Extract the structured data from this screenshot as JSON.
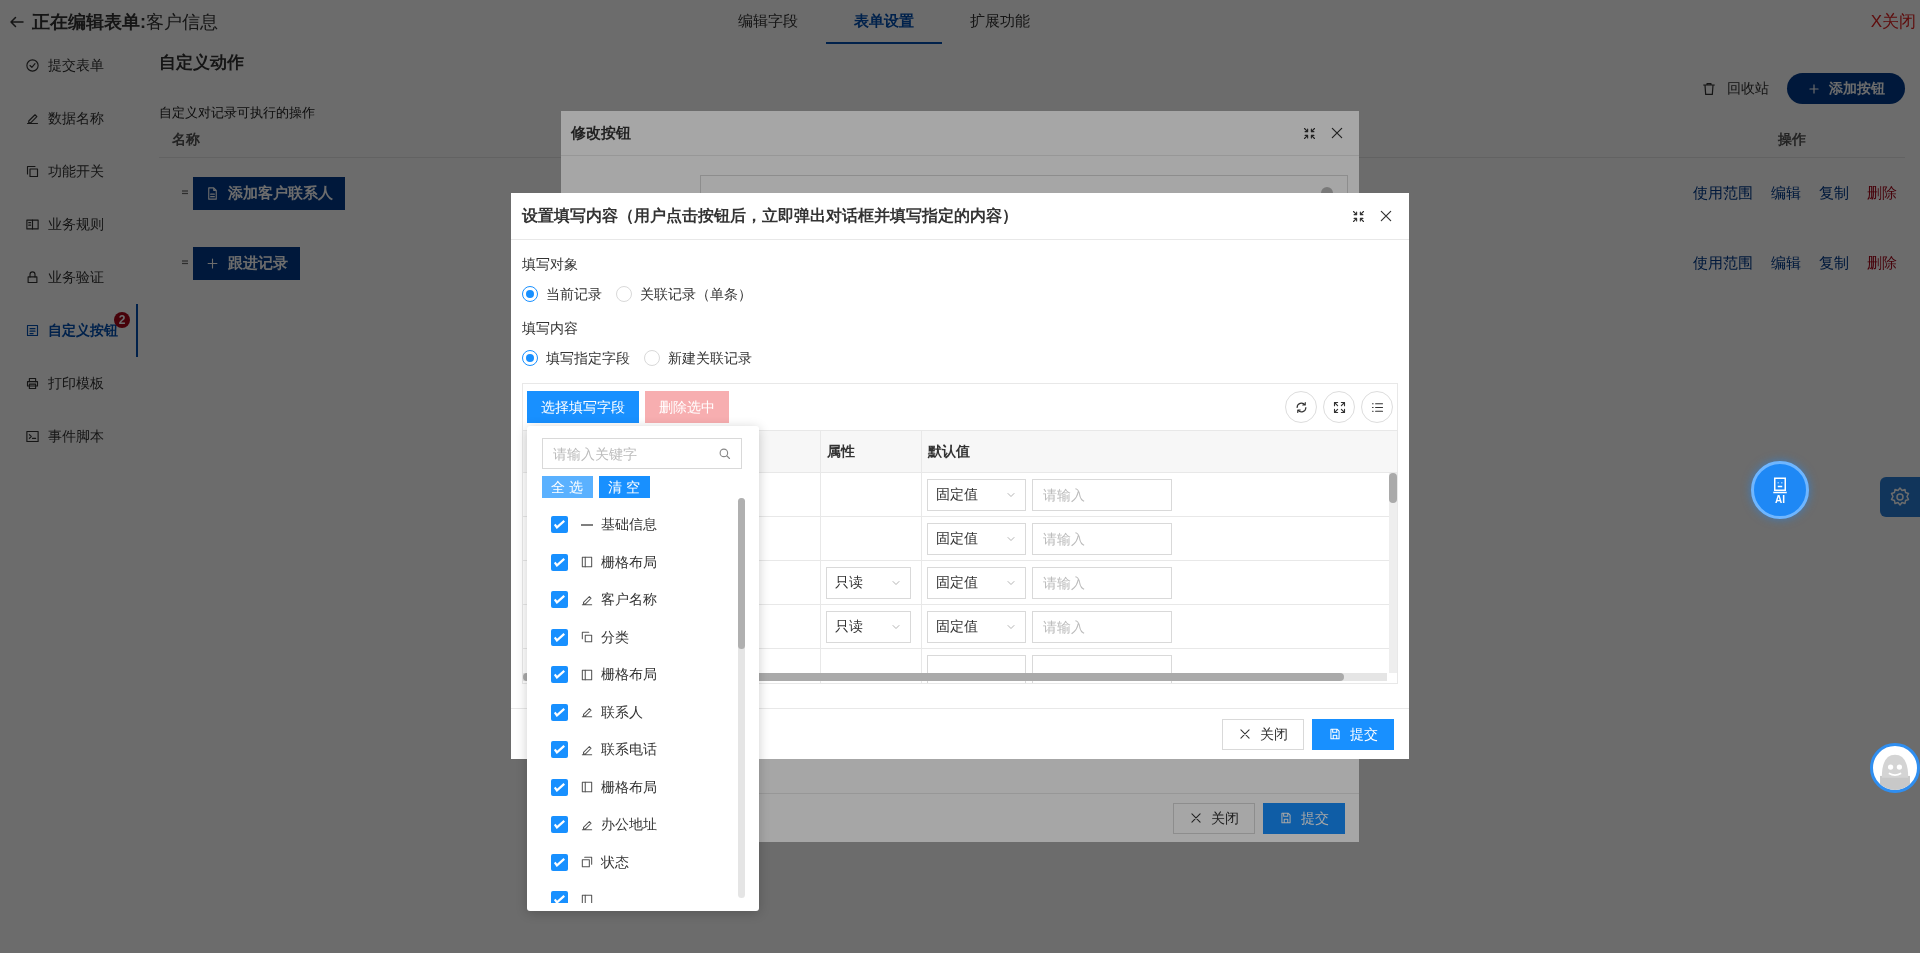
{
  "header": {
    "title": "**正在编辑表单:**客户信息",
    "close": "X关闭"
  },
  "tabs": [
    {
      "label": "编辑字段",
      "selected": false
    },
    {
      "label": "表单设置",
      "selected": true
    },
    {
      "label": "扩展功能",
      "selected": false
    }
  ],
  "sidebar": {
    "items": [
      {
        "label": "提交表单",
        "kind": "submit",
        "selected": false
      },
      {
        "label": "数据名称",
        "kind": "name",
        "selected": false
      },
      {
        "label": "功能开关",
        "kind": "switch",
        "selected": false
      },
      {
        "label": "业务规则",
        "kind": "rules",
        "selected": false
      },
      {
        "label": "业务验证",
        "kind": "validation",
        "selected": false
      },
      {
        "label": "自定义按钮",
        "kind": "button",
        "selected": true,
        "badge": "2"
      },
      {
        "label": "打印模板",
        "kind": "print",
        "selected": false
      },
      {
        "label": "事件脚本",
        "kind": "script",
        "selected": false
      }
    ]
  },
  "actions_panel": {
    "title": "自定义动作",
    "subtitle": "自定义对记录可执行的操作",
    "recycle_bin": "回收站",
    "add_button": "添加按钮",
    "columns": [
      "名称",
      "操作"
    ],
    "rows": [
      {
        "button": "添加客户联系人",
        "kind": "document",
        "actions": [
          {
            "label": "使用范围",
            "kind": "link"
          },
          {
            "label": "编辑",
            "kind": "link"
          },
          {
            "label": "复制",
            "kind": "link"
          },
          {
            "label": "删除",
            "kind": "danger"
          }
        ]
      },
      {
        "button": "跟进记录",
        "kind": "plus",
        "actions": [
          {
            "label": "使用范围",
            "kind": "link"
          },
          {
            "label": "编辑",
            "kind": "link"
          },
          {
            "label": "复制",
            "kind": "link"
          },
          {
            "label": "删除",
            "kind": "danger"
          }
        ]
      }
    ]
  },
  "edit_dialog": {
    "title": "修改按钮",
    "buttons": [
      {
        "label": "关闭",
        "kind": "default"
      },
      {
        "label": "提交",
        "kind": "primary"
      }
    ]
  },
  "fill_dialog": {
    "title": "设置填写内容（用户点击按钮后，立即弹出对话框并填写指定的内容）",
    "groups": [
      {
        "label": "填写对象",
        "options": [
          {
            "label": "当前记录",
            "selected": true
          },
          {
            "label": "关联记录（单条）",
            "selected": false
          }
        ]
      },
      {
        "label": "填写内容",
        "options": [
          {
            "label": "填写指定字段",
            "selected": true
          },
          {
            "label": "新建关联记录",
            "selected": false
          }
        ]
      }
    ],
    "toolbar": [
      {
        "label": "选择填写字段",
        "disabled": false
      },
      {
        "label": "删除选中",
        "disabled": true
      }
    ],
    "table": {
      "columns": [
        "属性",
        "默认值"
      ],
      "rows": [
        {
          "mode": "固定值",
          "placeholder": "请输入"
        },
        {
          "mode": "固定值",
          "placeholder": "请输入"
        },
        {
          "attribute": "只读",
          "mode": "固定值",
          "placeholder": "请输入"
        },
        {
          "attribute": "只读",
          "mode": "固定值",
          "placeholder": "请输入"
        },
        {
          "cut": true
        }
      ]
    },
    "buttons": [
      {
        "label": "关闭",
        "kind": "default"
      },
      {
        "label": "提交",
        "kind": "primary"
      }
    ]
  },
  "field_picker": {
    "placeholder": "请输入关键字",
    "select_all": {
      "label": "全选",
      "hovered": true
    },
    "clear": {
      "label": "清空",
      "hovered": false
    },
    "items": [
      {
        "label": "基础信息",
        "kind": "group",
        "checked": true
      },
      {
        "label": "栅格布局",
        "kind": "layout",
        "checked": true
      },
      {
        "label": "客户名称",
        "kind": "input",
        "checked": true
      },
      {
        "label": "分类",
        "kind": "cascade",
        "checked": true
      },
      {
        "label": "栅格布局",
        "kind": "layout",
        "checked": true
      },
      {
        "label": "联系人",
        "kind": "input",
        "checked": true
      },
      {
        "label": "联系电话",
        "kind": "input",
        "checked": true
      },
      {
        "label": "栅格布局",
        "kind": "layout",
        "checked": true
      },
      {
        "label": "办公地址",
        "kind": "input",
        "checked": true
      },
      {
        "label": "状态",
        "kind": "select",
        "checked": true
      },
      {
        "kind": "layout",
        "checked": true
      }
    ]
  },
  "assistant": {
    "label": "AI"
  }
}
